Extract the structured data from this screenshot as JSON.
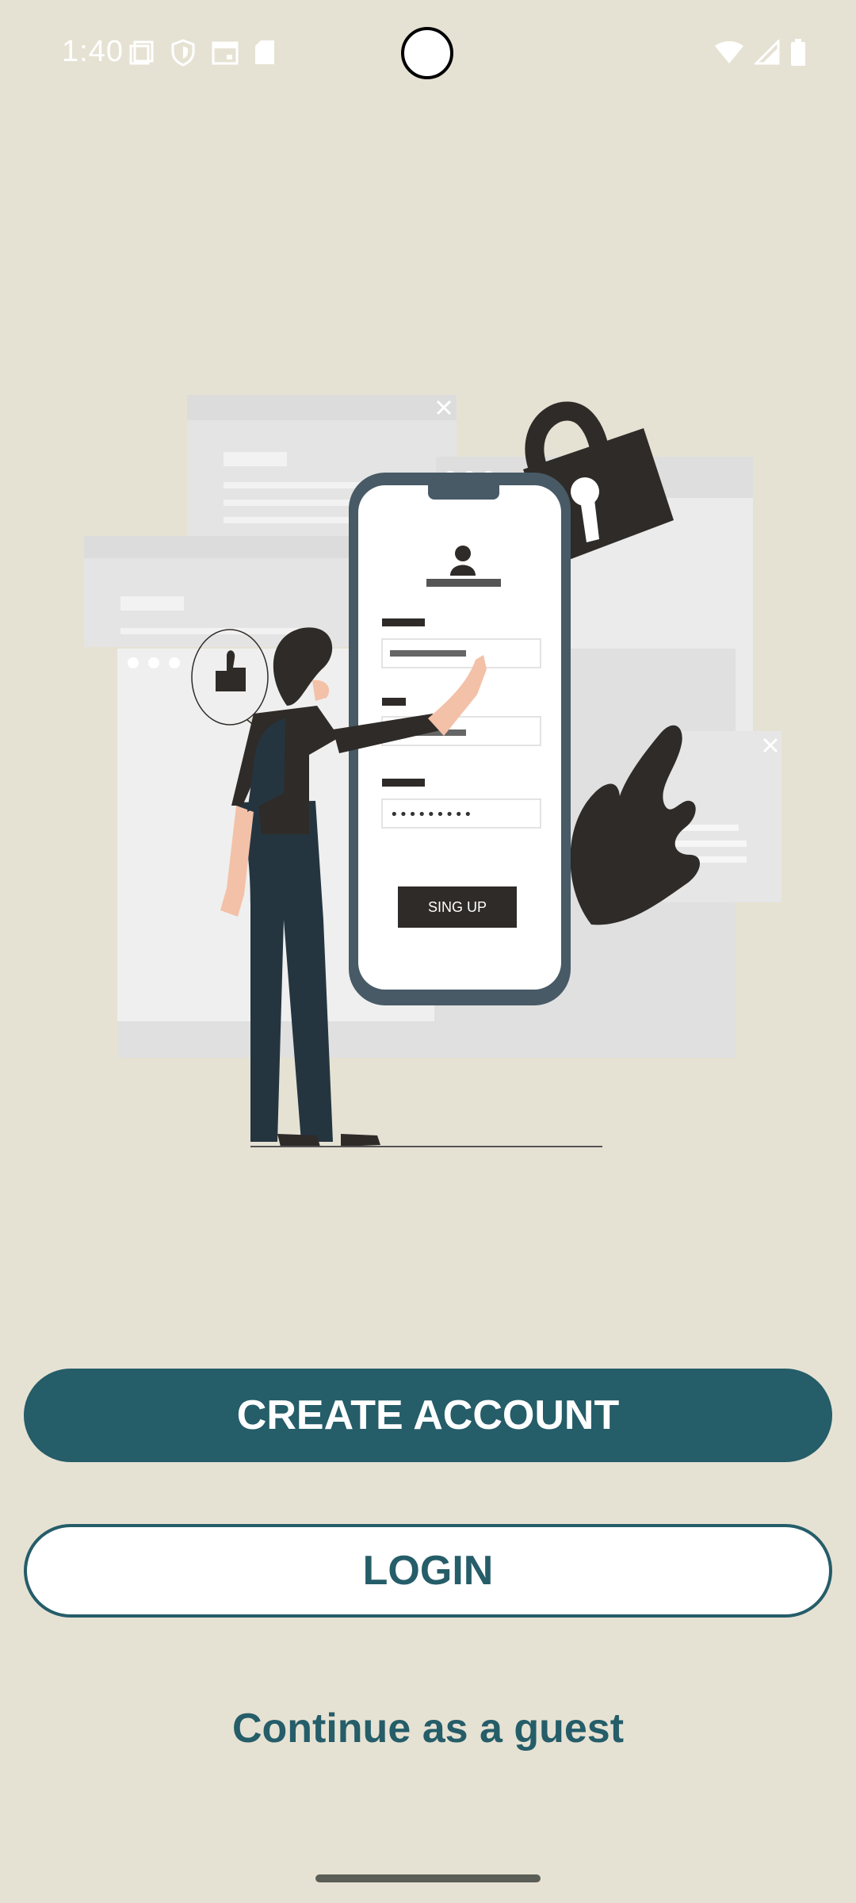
{
  "status_bar": {
    "time": "1:40",
    "left_icons": [
      "screen-icon",
      "shield-icon",
      "calendar-icon",
      "sd-card-icon"
    ],
    "right_icons": [
      "wifi-icon",
      "signal-icon",
      "battery-icon"
    ]
  },
  "illustration": {
    "signup_button_label": "SING UP",
    "password_mask": "•••••••••"
  },
  "actions": {
    "create_account_label": "CREATE ACCOUNT",
    "login_label": "LOGIN",
    "guest_label": "Continue as a guest"
  },
  "colors": {
    "background": "#e6e2d3",
    "primary": "#255d69",
    "dark": "#2f2b28",
    "phone_frame": "#475a66"
  }
}
